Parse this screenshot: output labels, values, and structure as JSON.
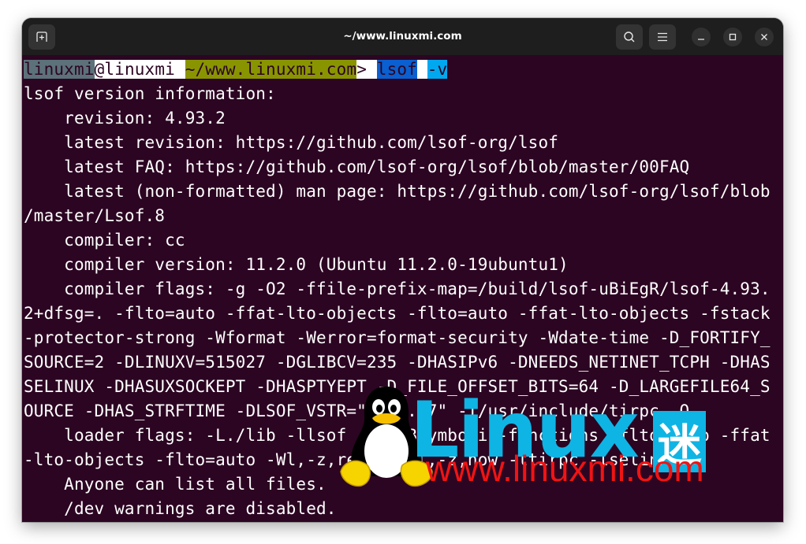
{
  "window": {
    "title": "~/www.linuxmi.com",
    "buttons": {
      "new_tab": "new-tab-icon",
      "search": "search-icon",
      "menu": "hamburger-menu-icon",
      "minimize": "minimize-icon",
      "maximize": "maximize-icon",
      "close": "close-icon"
    }
  },
  "prompt": {
    "user": "linuxmi",
    "at_host": "@linuxmi ",
    "dir": "~/www.linuxmi.com",
    "gt": "> ",
    "command": "lsof",
    "space": " ",
    "arg": "-v",
    "colors": {
      "user_bg": "#5c717a",
      "host_bg": "#ffffff",
      "dir_bg": "#899500",
      "cmd_bg": "#0a5fd1",
      "arg_bg": "#00a8f0"
    }
  },
  "output": [
    "lsof version information:",
    "    revision: 4.93.2",
    "    latest revision: https://github.com/lsof-org/lsof",
    "    latest FAQ: https://github.com/lsof-org/lsof/blob/master/00FAQ",
    "    latest (non-formatted) man page: https://github.com/lsof-org/lsof/blob",
    "/master/Lsof.8",
    "    compiler: cc",
    "    compiler version: 11.2.0 (Ubuntu 11.2.0-19ubuntu1)",
    "    compiler flags: -g -O2 -ffile-prefix-map=/build/lsof-uBiEgR/lsof-4.93.",
    "2+dfsg=. -flto=auto -ffat-lto-objects -flto=auto -ffat-lto-objects -fstack",
    "-protector-strong -Wformat -Werror=format-security -Wdate-time -D_FORTIFY_",
    "SOURCE=2 -DLINUXV=515027 -DGLIBCV=235 -DHASIPv6 -DNEEDS_NETINET_TCPH -DHAS",
    "SELINUX -DHASUXSOCKEPT -DHASPTYEPT -D_FILE_OFFSET_BITS=64 -D_LARGEFILE64_S",
    "OURCE -DHAS_STRFTIME -DLSOF_VSTR=\"5.15.27\" -I/usr/include/tirpc -O",
    "    loader flags: -L./lib -llsof -Wl,-Bsymbolic-functions -flto=auto -ffat",
    "-lto-objects -flto=auto -Wl,-z,relro -Wl,-z,now -ltirpc -lselinux",
    "    Anyone can list all files.",
    "    /dev warnings are disabled."
  ],
  "watermark": {
    "logo_text": "Linux",
    "logo_cjk": "迷",
    "url": "www.linuxmi.com",
    "logo_color": "#0eb4e4",
    "url_color": "#f01414"
  }
}
